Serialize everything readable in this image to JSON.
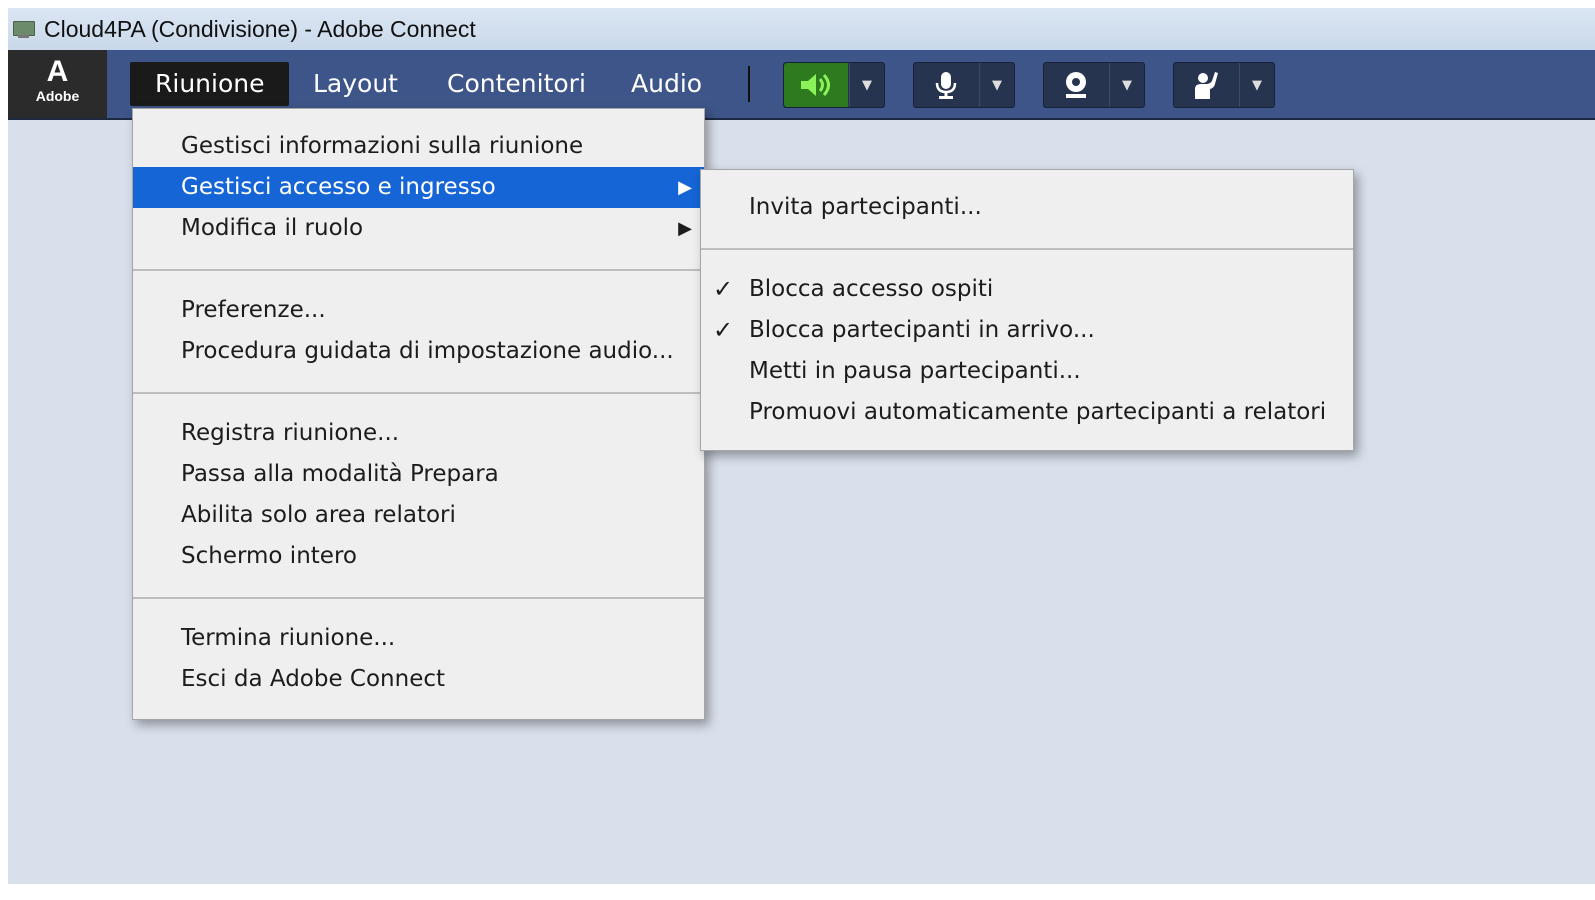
{
  "window": {
    "title": "Cloud4PA (Condivisione) - Adobe Connect"
  },
  "logo": {
    "glyph": "A",
    "text": "Adobe"
  },
  "menubar": {
    "items": [
      {
        "label": "Riunione"
      },
      {
        "label": "Layout"
      },
      {
        "label": "Contenitori"
      },
      {
        "label": "Audio"
      }
    ]
  },
  "toolbar": {
    "speaker_icon": "speaker-icon",
    "mic_icon": "microphone-icon",
    "webcam_icon": "webcam-icon",
    "raise_hand_icon": "raise-hand-icon",
    "speaker_active_color": "#2d7a1f"
  },
  "riunione_menu": {
    "group1": [
      {
        "label": "Gestisci informazioni sulla riunione"
      },
      {
        "label": "Gestisci accesso e ingresso",
        "highlighted": true,
        "submenu": true
      },
      {
        "label": "Modifica il ruolo",
        "submenu": true
      }
    ],
    "group2": [
      {
        "label": "Preferenze..."
      },
      {
        "label": "Procedura guidata di impostazione audio..."
      }
    ],
    "group3": [
      {
        "label": "Registra riunione..."
      },
      {
        "label": "Passa alla modalità Prepara"
      },
      {
        "label": "Abilita solo area relatori"
      },
      {
        "label": "Schermo intero"
      }
    ],
    "group4": [
      {
        "label": "Termina riunione..."
      },
      {
        "label": "Esci da Adobe Connect"
      }
    ]
  },
  "access_submenu": {
    "group1": [
      {
        "label": "Invita partecipanti..."
      }
    ],
    "group2": [
      {
        "label": "Blocca accesso ospiti",
        "checked": true
      },
      {
        "label": "Blocca partecipanti in arrivo...",
        "checked": true
      },
      {
        "label": "Metti in pausa partecipanti...",
        "checked": false
      },
      {
        "label": "Promuovi automaticamente partecipanti a relatori",
        "checked": false
      }
    ]
  }
}
